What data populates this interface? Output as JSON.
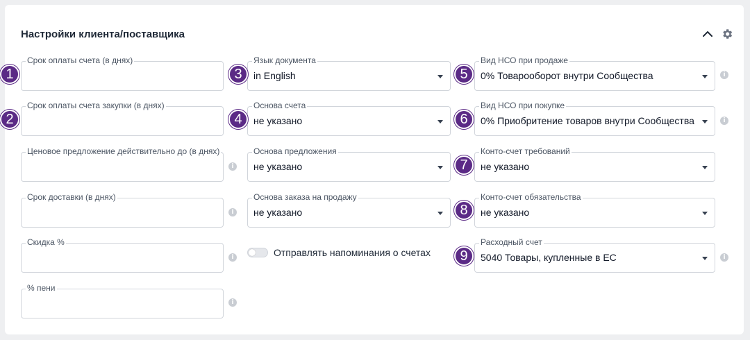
{
  "section": {
    "title": "Настройки клиента/поставщика"
  },
  "col1": [
    {
      "label": "Срок оплаты счета (в днях)",
      "value": ""
    },
    {
      "label": "Срок оплаты счета закупки (в днях)",
      "value": ""
    },
    {
      "label": "Ценовое предложение действительно до (в днях)",
      "value": ""
    },
    {
      "label": "Срок доставки (в днях)",
      "value": ""
    },
    {
      "label": "Скидка %",
      "value": ""
    },
    {
      "label": "% пени",
      "value": ""
    }
  ],
  "col2": [
    {
      "label": "Язык документа",
      "value": "in English"
    },
    {
      "label": "Основа счета",
      "value": "не указано"
    },
    {
      "label": "Основа предложения",
      "value": "не указано"
    },
    {
      "label": "Основа заказа на продажу",
      "value": "не указано"
    }
  ],
  "toggle": {
    "label": "Отправлять напоминания о счетах",
    "on": false
  },
  "col3": [
    {
      "label": "Вид НСО при продаже",
      "value": "0% Товарооборот внутри Сообщества"
    },
    {
      "label": "Вид НСО при покупке",
      "value": "0% Приобритение товаров внутри Сообщества"
    },
    {
      "label": "Конто-счет требований",
      "value": "не указано"
    },
    {
      "label": "Конто-счет обязательства",
      "value": "не указано"
    },
    {
      "label": "Расходный счет",
      "value": "5040 Товары, купленные в ЕС"
    }
  ],
  "badges": [
    "1",
    "2",
    "3",
    "4",
    "5",
    "6",
    "7",
    "8",
    "9"
  ],
  "info_symbol": "i",
  "colors": {
    "badge": "#5b2a86",
    "border": "#d1d5db",
    "background": "#eeeff1"
  }
}
